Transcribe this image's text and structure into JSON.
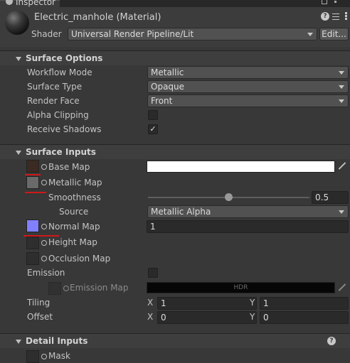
{
  "window": {
    "tab_title": "Inspector"
  },
  "header": {
    "material_title": "Electric_manhole (Material)",
    "shader_label": "Shader",
    "shader_value": "Universal Render Pipeline/Lit",
    "edit_button": "Edit..."
  },
  "surface_options": {
    "title": "Surface Options",
    "rows": [
      {
        "label": "Workflow Mode",
        "value": "Metallic"
      },
      {
        "label": "Surface Type",
        "value": "Opaque"
      },
      {
        "label": "Render Face",
        "value": "Front"
      },
      {
        "label": "Alpha Clipping",
        "checked": false
      },
      {
        "label": "Receive Shadows",
        "checked": true
      }
    ]
  },
  "surface_inputs": {
    "title": "Surface Inputs",
    "base_map": {
      "label": "Base Map",
      "color": "#ffffff"
    },
    "metallic_map": {
      "label": "Metallic Map"
    },
    "smoothness": {
      "label": "Smoothness",
      "value": "0.5",
      "fraction": 0.5
    },
    "source": {
      "label": "Source",
      "value": "Metallic Alpha"
    },
    "normal_map": {
      "label": "Normal Map",
      "value": "1"
    },
    "height_map": {
      "label": "Height Map"
    },
    "occlusion_map": {
      "label": "Occlusion Map"
    },
    "emission": {
      "label": "Emission",
      "checked": false
    },
    "emission_map": {
      "label": "Emission Map",
      "hdr": "HDR"
    },
    "tiling": {
      "label": "Tiling",
      "x_label": "X",
      "x": "1",
      "y_label": "Y",
      "y": "1"
    },
    "offset": {
      "label": "Offset",
      "x_label": "X",
      "x": "0",
      "y_label": "Y",
      "y": "0"
    }
  },
  "detail_inputs": {
    "title": "Detail Inputs",
    "mask": {
      "label": "Mask"
    }
  },
  "colors": {
    "annotation_red": "#d01818",
    "normal_map_tint": "#8080ff"
  }
}
